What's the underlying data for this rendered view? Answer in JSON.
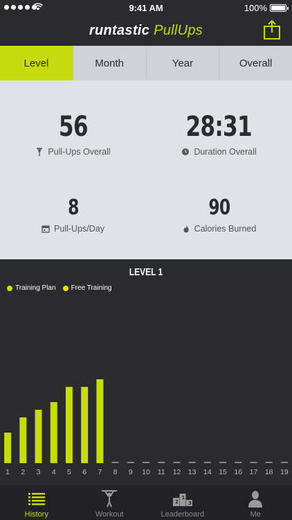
{
  "status": {
    "time": "9:41 AM",
    "battery": "100%"
  },
  "header": {
    "brand_part1": "runtastic",
    "brand_part2": "PullUps",
    "share_icon": "share-icon"
  },
  "tabs": [
    {
      "label": "Level",
      "active": true
    },
    {
      "label": "Month",
      "active": false
    },
    {
      "label": "Year",
      "active": false
    },
    {
      "label": "Overall",
      "active": false
    }
  ],
  "stats": {
    "pullups_overall": {
      "value": "56",
      "label": "Pull-Ups Overall",
      "icon": "pullup-figure-icon"
    },
    "duration_overall": {
      "value": "28:31",
      "label": "Duration Overall",
      "icon": "clock-icon"
    },
    "pullups_day": {
      "value": "8",
      "label": "Pull-Ups/Day",
      "icon": "calendar-icon"
    },
    "calories": {
      "value": "90",
      "label": "Calories Burned",
      "icon": "flame-icon"
    }
  },
  "chart_title": "LEVEL 1",
  "colors": {
    "accent": "#c6dc0f",
    "free_training": "#f1dd18",
    "bg": "#2b2b2d"
  },
  "chart_data": {
    "type": "bar",
    "title": "LEVEL 1",
    "categories": [
      "1",
      "2",
      "3",
      "4",
      "5",
      "6",
      "7",
      "8",
      "9",
      "10",
      "11",
      "12",
      "13",
      "14",
      "15",
      "16",
      "17",
      "18",
      "19"
    ],
    "series": [
      {
        "name": "Training Plan",
        "values": [
          4,
          6,
          7,
          8,
          10,
          10,
          11,
          0,
          0,
          0,
          0,
          0,
          0,
          0,
          0,
          0,
          0,
          0,
          0
        ]
      },
      {
        "name": "Free Training",
        "values": [
          0,
          0,
          0,
          0,
          0,
          0,
          0,
          0,
          0,
          0,
          0,
          0,
          0,
          0,
          0,
          0,
          0,
          0,
          0
        ]
      }
    ],
    "ylim": [
      0,
      22
    ],
    "legend": "top-left",
    "grid": false
  },
  "tabbar": [
    {
      "label": "History",
      "icon": "history-list-icon",
      "active": true
    },
    {
      "label": "Workout",
      "icon": "workout-figure-icon",
      "active": false
    },
    {
      "label": "Leaderboard",
      "icon": "podium-icon",
      "active": false
    },
    {
      "label": "Me",
      "icon": "profile-icon",
      "active": false
    }
  ]
}
